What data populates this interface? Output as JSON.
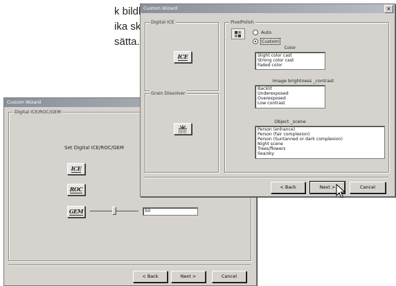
{
  "background_text": {
    "line1": "k bildbehandling).",
    "line2": "ika skannermodel-",
    "line3": "sätta."
  },
  "back_window": {
    "title": "Custom Wizard",
    "group_title": "Digital ICE/ROC/GEM",
    "heading": "Set Digital ICE/ROC/GEM",
    "ice_icon_label": "ICE",
    "roc_icon_label": "ROC",
    "gem_icon_label": "GEM",
    "gem_value": "50",
    "gem_slider_level": 0.5,
    "buttons": {
      "back": "< Back",
      "next": "Next >",
      "cancel": "Cancel"
    }
  },
  "front_window": {
    "title": "Custom Wizard",
    "close_glyph": "×",
    "groups": {
      "digital_ice": "Digital ICE",
      "grain_dissolver": "Grain Dissolver",
      "pixelpolish": "PixelPolish"
    },
    "ice_icon_label": "ICE",
    "radio_auto": "Auto",
    "radio_custom": "Custom",
    "color_label": "Color",
    "color_items": [
      "Slight color cast",
      "Strong color cast",
      "Faded color"
    ],
    "brightness_label": "Image brightness _contrast",
    "brightness_items": [
      "Backlit",
      "Underexposed",
      "Overexposed",
      "Low contrast"
    ],
    "scene_label": "Object _scene",
    "scene_items": [
      "Person (enhance)",
      "Person (fair complexion)",
      "Person (Suntanned or dark complexion)",
      "Night scene",
      "Trees/flowers",
      "Sea/sky"
    ],
    "buttons": {
      "back": "< Back",
      "next": "Next >",
      "cancel": "Cancel"
    }
  }
}
